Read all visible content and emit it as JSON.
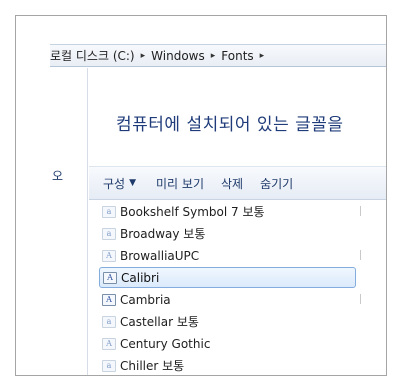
{
  "breadcrumb": {
    "segments": [
      "로컬 디스크 (C:)",
      "Windows",
      "Fonts"
    ],
    "separator": "▸"
  },
  "nav": {
    "visible_text": "오"
  },
  "heading": "컴퓨터에 설치되어 있는 글꼴을",
  "toolbar": {
    "organize_label": "구성",
    "organize_caret": "▼",
    "preview_label": "미리 보기",
    "delete_label": "삭제",
    "hide_label": "숨기기"
  },
  "fonts": [
    {
      "name": "Bookshelf Symbol 7 보통",
      "icon": "font-file-icon",
      "selected": false
    },
    {
      "name": "Broadway 보통",
      "icon": "font-file-icon",
      "selected": false
    },
    {
      "name": "BrowalliaUPC",
      "icon": "font-family-icon",
      "selected": false
    },
    {
      "name": "Calibri",
      "icon": "font-family-icon",
      "selected": true
    },
    {
      "name": "Cambria",
      "icon": "font-family-icon",
      "selected": false
    },
    {
      "name": "Castellar 보통",
      "icon": "font-file-icon",
      "selected": false
    },
    {
      "name": "Century Gothic",
      "icon": "font-family-icon",
      "selected": false
    },
    {
      "name": "Chiller 보통",
      "icon": "font-file-icon",
      "selected": false
    }
  ],
  "colors": {
    "heading": "#1f3b7a",
    "toolbar_text": "#1e3a6a",
    "selection_border": "#84acdd",
    "selection_fill": "#dbeafc"
  }
}
